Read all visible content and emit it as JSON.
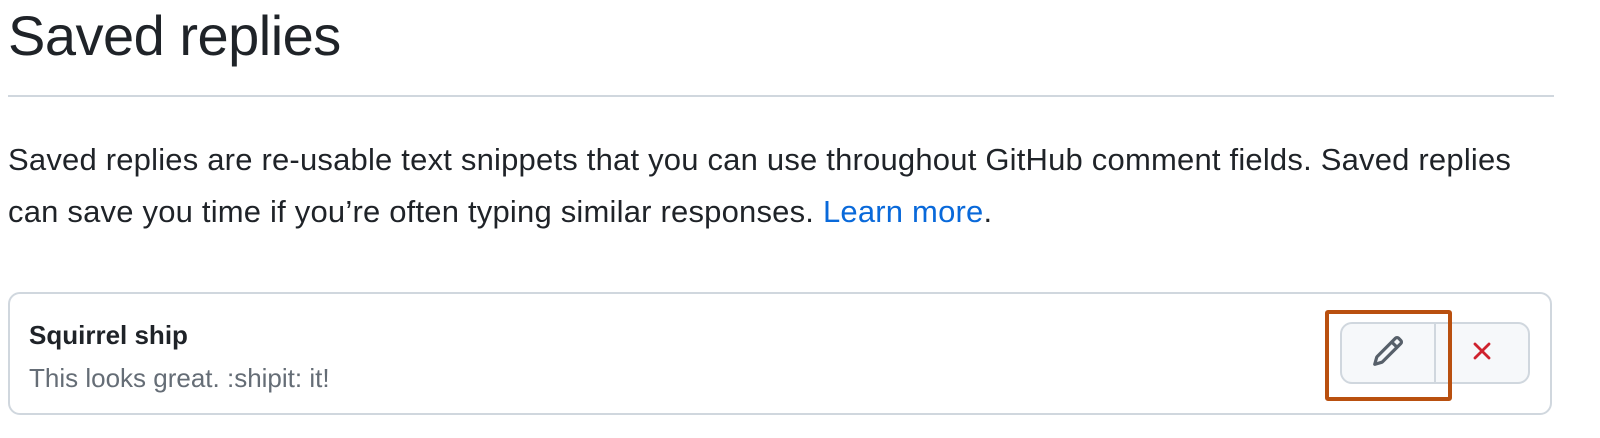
{
  "page": {
    "title": "Saved replies",
    "description": "Saved replies are re-usable text snippets that you can use throughout GitHub comment fields. Saved replies can save you time if you’re often typing similar responses.",
    "learn_more_label": "Learn more",
    "description_end": "."
  },
  "saved_replies": [
    {
      "title": "Squirrel ship",
      "body": "This looks great. :shipit: it!",
      "edit_icon": "pencil-icon",
      "delete_icon": "x-icon"
    }
  ],
  "colors": {
    "link": "#0969da",
    "delete_icon": "#cf222e",
    "highlight": "#b9500f"
  }
}
